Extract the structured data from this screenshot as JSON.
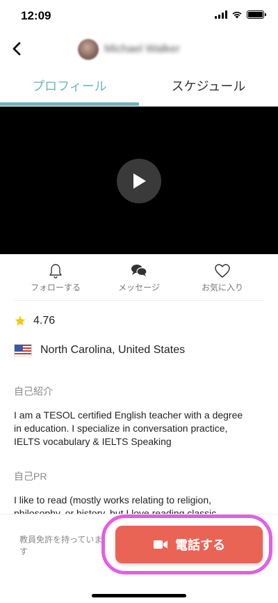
{
  "status_bar": {
    "time": "12:09"
  },
  "header": {
    "back_icon": "chevron-left-icon",
    "user_name": "Michael Walker"
  },
  "tabs": [
    {
      "label": "プロフィール",
      "active": true
    },
    {
      "label": "スケジュール",
      "active": false
    }
  ],
  "video": {
    "play_icon": "play-icon"
  },
  "actions": [
    {
      "label": "フォローする",
      "icon": "bell-icon"
    },
    {
      "label": "メッセージ",
      "icon": "chat-bubbles-icon"
    },
    {
      "label": "お気に入り",
      "icon": "heart-icon"
    }
  ],
  "rating": {
    "value": "4.76",
    "icon": "star-icon"
  },
  "location": {
    "text": "North Carolina, United States",
    "flag": "us-flag-icon"
  },
  "intro": {
    "title": "自己紹介",
    "body": "I am a TESOL certified English teacher with a degree in education. I specialize in conversation practice,  IELTS vocabulary & IELTS Speaking"
  },
  "pr": {
    "title": "自己PR",
    "body": "I like to read (mostly works relating to religion, philosophy, or history, but I love reading classic"
  },
  "bottom": {
    "note": "教員免許を持っています",
    "call_label": "電話する",
    "call_icon": "video-camera-icon"
  },
  "colors": {
    "accent": "#6fb5bf",
    "call_button": "#ea6455",
    "highlight": "#e35de6",
    "star": "#f5c518"
  }
}
